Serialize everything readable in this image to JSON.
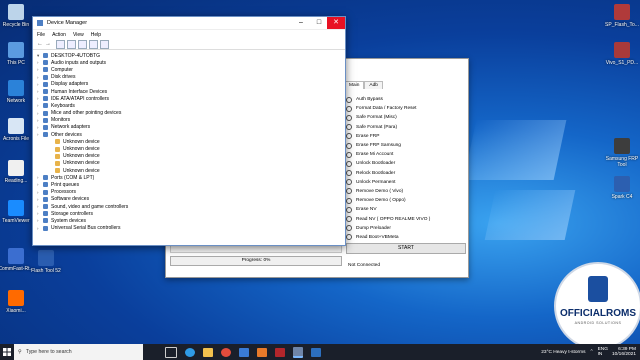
{
  "desktop": {
    "icons_left": [
      "Recycle Bin",
      "This PC",
      "Network",
      "Acronis File",
      "Reading...",
      "TeamViewer",
      "CommFast-Rt...",
      "Xiaomi..."
    ],
    "icons_left_extra": "Flash Tool 52",
    "icons_right": [
      "SP_Flash_To...",
      "Vivo_S1_PD...",
      "Samsung FRP Tool",
      "Spark C4"
    ]
  },
  "device_manager": {
    "title": "Device Manager",
    "menu": [
      "File",
      "Action",
      "View",
      "Help"
    ],
    "root": "DESKTOP-4UTOBTG",
    "categories": [
      "Audio inputs and outputs",
      "Computer",
      "Disk drives",
      "Display adapters",
      "Human Interface Devices",
      "IDE ATA/ATAPI controllers",
      "Keyboards",
      "Mice and other pointing devices",
      "Monitors",
      "Network adapters",
      "Other devices"
    ],
    "other_devices": [
      "Unknown device",
      "Unknown device",
      "Unknown device",
      "Unknown device",
      "Unknown device"
    ],
    "categories_after": [
      "Ports (COM & LPT)",
      "Print queues",
      "Processors",
      "Software devices",
      "Sound, video and game controllers",
      "Storage controllers",
      "System devices",
      "Universal Serial Bus controllers"
    ]
  },
  "tool": {
    "tabs": [
      "Main",
      "Adb"
    ],
    "options": [
      "Auth Bypass",
      "Format Data / Factory Reset",
      "Safe Format (Misc)",
      "Safe Format (Para)",
      "Erase FRP",
      "Erase FRP Samsung",
      "Erase Mi Account",
      "Unlock Bootloader",
      "Relock Bootloader",
      "Unlock Permanent",
      "Remove Demo ( Vivo)",
      "Remove Demo ( Oppo)",
      "Erase NV",
      "Read NV ( OPPO REALME VIVO )",
      "Dump Preloader",
      "Read Boot+VBMeta"
    ],
    "start_label": "START",
    "status": "Not Connected",
    "progress_label": "Progress: 0%"
  },
  "taskbar": {
    "search_placeholder": "Type here to search",
    "weather": "23°C  Heavy t-storms",
    "lang": "ENG",
    "region": "IN",
    "time": "6:39 PM",
    "date": "10/16/2021"
  },
  "logo": {
    "brand": "OFFICIALROMS",
    "tagline": "ANDROID SOLUTIONS"
  }
}
